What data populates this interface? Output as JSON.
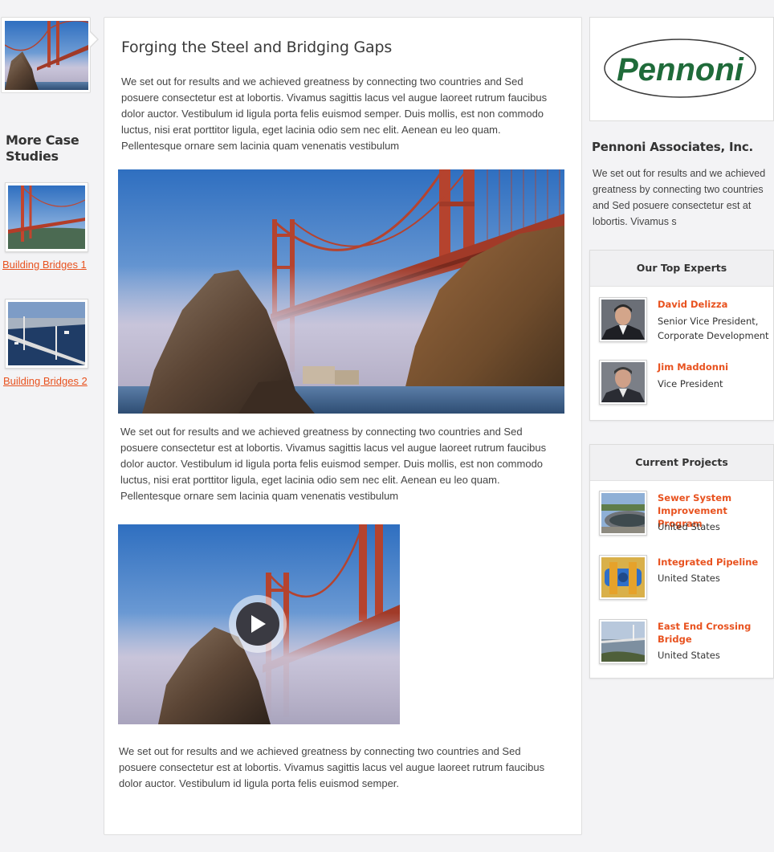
{
  "sidebar": {
    "more_title": "More Case Studies",
    "case_studies": [
      {
        "label": "Building Bridges 1"
      },
      {
        "label": "Building Bridges 2"
      }
    ]
  },
  "article": {
    "title": "Forging the Steel and Bridging Gaps",
    "para1": "We set out for results and we achieved greatness by connecting two countries and Sed posuere consectetur est at lobortis. Vivamus sagittis lacus vel augue laoreet rutrum faucibus dolor auctor. Vestibulum id ligula porta felis euismod semper. Duis mollis, est non commodo luctus, nisi erat porttitor ligula, eget lacinia odio sem nec elit. Aenean eu leo quam. Pellentesque ornare sem lacinia quam venenatis vestibulum",
    "para2": "We set out for results and we achieved greatness by connecting two countries and Sed posuere consectetur est at lobortis. Vivamus sagittis lacus vel augue laoreet rutrum faucibus dolor auctor. Vestibulum id ligula porta felis euismod semper. Duis mollis, est non commodo luctus, nisi erat porttitor ligula, eget lacinia odio sem nec elit. Aenean eu leo quam. Pellentesque ornare sem lacinia quam venenatis vestibulum",
    "para3": "We set out for results and we achieved greatness by connecting two countries and Sed posuere consectetur est at lobortis. Vivamus sagittis lacus vel augue laoreet rutrum faucibus dolor auctor. Vestibulum id ligula porta felis euismod semper."
  },
  "company": {
    "logo_text": "Pennoni",
    "name": "Pennoni Associates, Inc.",
    "description": "We set out for results and we achieved greatness by connecting two countries and Sed posuere consectetur est at lobortis. Vivamus s"
  },
  "experts": {
    "title": "Our Top Experts",
    "people": [
      {
        "name": "David Delizza",
        "role_line1": "Senior Vice President,",
        "role_line2": "Corporate Development"
      },
      {
        "name": "Jim Maddonni",
        "role_line1": "Vice President"
      }
    ]
  },
  "projects": {
    "title": "Current Projects",
    "items": [
      {
        "name_line1": "Sewer System",
        "name_line2": "Improvement Program",
        "location": "United States"
      },
      {
        "name_line1": "Integrated Pipeline",
        "location": "United States"
      },
      {
        "name_line1": "East End Crossing",
        "name_line2": "Bridge",
        "location": "United States"
      }
    ]
  },
  "colors": {
    "accent": "#e8521f",
    "logo_green": "#1f6b3a"
  },
  "icons": {
    "video_play": "play-icon"
  }
}
